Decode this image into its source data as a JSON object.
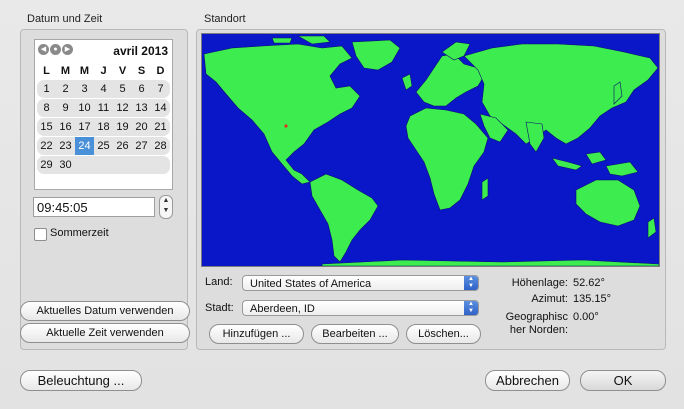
{
  "left_panel": {
    "title": "Datum und Zeit",
    "calendar": {
      "month_label": "avril 2013",
      "nav_icons": [
        "back-icon",
        "today-icon",
        "forward-icon"
      ],
      "weekday_headers": [
        "L",
        "M",
        "M",
        "J",
        "V",
        "S",
        "D"
      ],
      "weeks": [
        [
          "1",
          "2",
          "3",
          "4",
          "5",
          "6",
          "7"
        ],
        [
          "8",
          "9",
          "10",
          "11",
          "12",
          "13",
          "14"
        ],
        [
          "15",
          "16",
          "17",
          "18",
          "19",
          "20",
          "21"
        ],
        [
          "22",
          "23",
          "24",
          "25",
          "26",
          "27",
          "28"
        ],
        [
          "29",
          "30",
          "",
          "",
          "",
          "",
          ""
        ]
      ],
      "selected_day": "24",
      "selected_color": "#4a90d9"
    },
    "time_value": "09:45:05",
    "daylight_saving_label": "Sommerzeit",
    "use_current_date_label": "Aktuelles Datum verwenden",
    "use_current_time_label": "Aktuelle Zeit verwenden"
  },
  "right_panel": {
    "title": "Standort",
    "map": {
      "ocean_color": "#0a17c9",
      "land_color": "#3dec4f"
    },
    "country_label": "Land:",
    "country_value": "United States of America",
    "city_label": "Stadt:",
    "city_value": "Aberdeen, ID",
    "add_label": "Hinzufügen ...",
    "edit_label": "Bearbeiten ...",
    "delete_label": "Löschen...",
    "elevation_label": "Höhenlage:",
    "elevation_value": "52.62°",
    "azimuth_label": "Azimut:",
    "azimuth_value": "135.15°",
    "north_label_line1": "Geographisc",
    "north_label_line2": "her Norden:",
    "north_value": "0.00°"
  },
  "footer": {
    "lighting_label": "Beleuchtung ...",
    "cancel_label": "Abbrechen",
    "ok_label": "OK"
  }
}
